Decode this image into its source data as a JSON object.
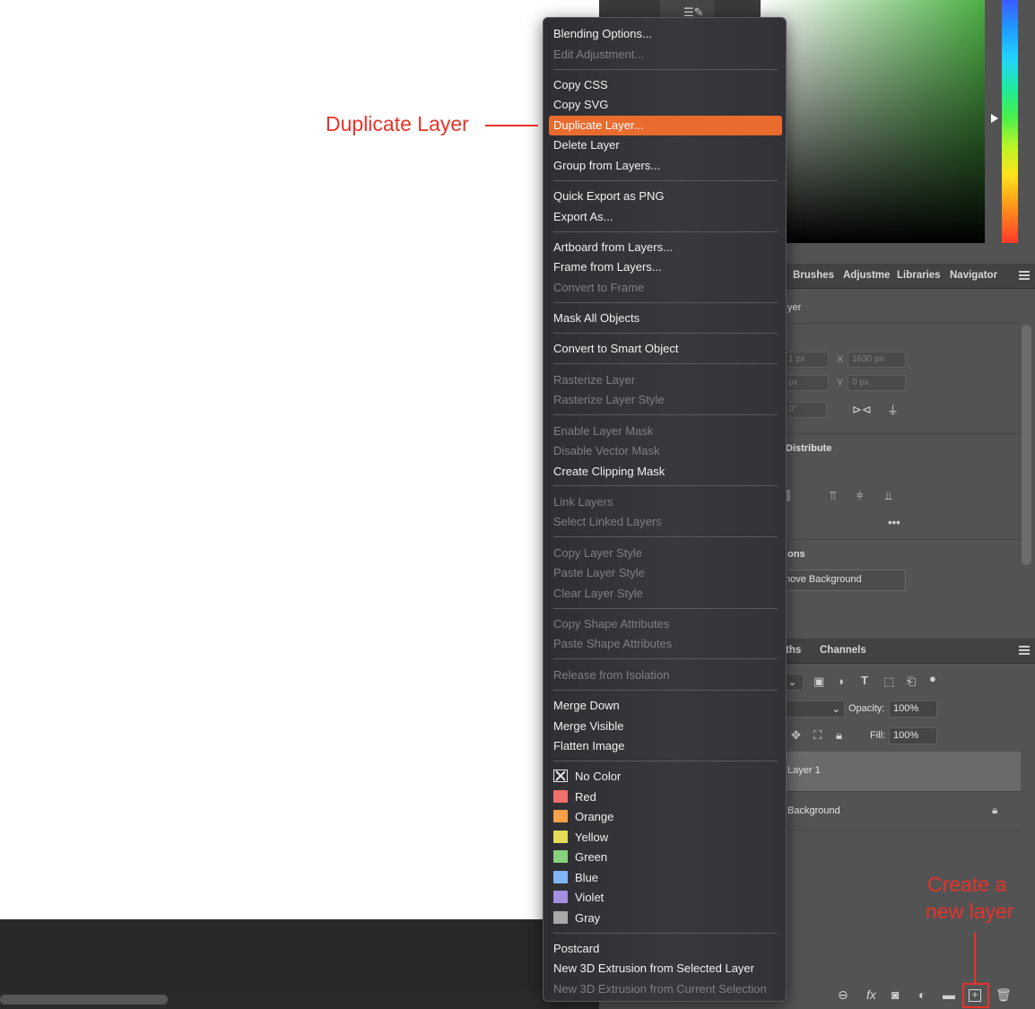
{
  "tool_glyph": "☰✎",
  "context_menu": {
    "items": [
      {
        "label": "Blending Options...",
        "enabled": true
      },
      {
        "label": "Edit Adjustment...",
        "enabled": false
      },
      {
        "label": "Copy CSS",
        "enabled": true
      },
      {
        "label": "Copy SVG",
        "enabled": true
      },
      {
        "label": "Duplicate Layer...",
        "enabled": true,
        "highlighted": true
      },
      {
        "label": "Delete Layer",
        "enabled": true
      },
      {
        "label": "Group from Layers...",
        "enabled": true
      },
      {
        "label": "Quick Export as PNG",
        "enabled": true
      },
      {
        "label": "Export As...",
        "enabled": true
      },
      {
        "label": "Artboard from Layers...",
        "enabled": true
      },
      {
        "label": "Frame from Layers...",
        "enabled": true
      },
      {
        "label": "Convert to Frame",
        "enabled": false
      },
      {
        "label": "Mask All Objects",
        "enabled": true
      },
      {
        "label": "Convert to Smart Object",
        "enabled": true
      },
      {
        "label": "Rasterize Layer",
        "enabled": false
      },
      {
        "label": "Rasterize Layer Style",
        "enabled": false
      },
      {
        "label": "Enable Layer Mask",
        "enabled": false
      },
      {
        "label": "Disable Vector Mask",
        "enabled": false
      },
      {
        "label": "Create Clipping Mask",
        "enabled": true
      },
      {
        "label": "Link Layers",
        "enabled": false
      },
      {
        "label": "Select Linked Layers",
        "enabled": false
      },
      {
        "label": "Copy Layer Style",
        "enabled": false
      },
      {
        "label": "Paste Layer Style",
        "enabled": false
      },
      {
        "label": "Clear Layer Style",
        "enabled": false
      },
      {
        "label": "Copy Shape Attributes",
        "enabled": false
      },
      {
        "label": "Paste Shape Attributes",
        "enabled": false
      },
      {
        "label": "Release from Isolation",
        "enabled": false
      },
      {
        "label": "Merge Down",
        "enabled": true
      },
      {
        "label": "Merge Visible",
        "enabled": true
      },
      {
        "label": "Flatten Image",
        "enabled": true
      },
      {
        "label": "No Color",
        "enabled": true
      },
      {
        "label": "Red",
        "enabled": true,
        "swatch": "#f0706a"
      },
      {
        "label": "Orange",
        "enabled": true,
        "swatch": "#f6a04a"
      },
      {
        "label": "Yellow",
        "enabled": true,
        "swatch": "#e6dc58"
      },
      {
        "label": "Green",
        "enabled": true,
        "swatch": "#86d27a"
      },
      {
        "label": "Blue",
        "enabled": true,
        "swatch": "#82b6f6"
      },
      {
        "label": "Violet",
        "enabled": true,
        "swatch": "#a58fe0"
      },
      {
        "label": "Gray",
        "enabled": true,
        "swatch": "#a9a9a9"
      },
      {
        "label": "Postcard",
        "enabled": true
      },
      {
        "label": "New 3D Extrusion from Selected Layer",
        "enabled": true
      },
      {
        "label": "New 3D Extrusion from Current Selection",
        "enabled": false
      }
    ]
  },
  "panels": {
    "tabs_top": [
      "Brushes",
      "Adjustme",
      "Libraries",
      "Navigator"
    ],
    "properties": {
      "layer_label": "yer",
      "w_value": "1 px",
      "x_label": "X",
      "x_value": "1630 px",
      "h_value": "px",
      "y_label": "Y",
      "y_value": "0 px",
      "angle_value": "0°",
      "align_title": "Distribute",
      "actions_title": "ons",
      "remove_bg_label": "nove Background"
    },
    "tabs_layers": [
      "ths",
      "Channels"
    ],
    "layers": {
      "opacity_label": "Opacity:",
      "opacity_value": "100%",
      "fill_label": "Fill:",
      "fill_value": "100%",
      "rows": [
        {
          "name": "Layer 1",
          "selected": true
        },
        {
          "name": "Background",
          "selected": false,
          "locked": true
        }
      ]
    }
  },
  "annotations": {
    "duplicate": "Duplicate Layer",
    "new_layer_line1": "Create a",
    "new_layer_line2": "new layer"
  },
  "colors": {
    "menu_highlight": "#e96b2e",
    "annotation": "#e6332a"
  }
}
